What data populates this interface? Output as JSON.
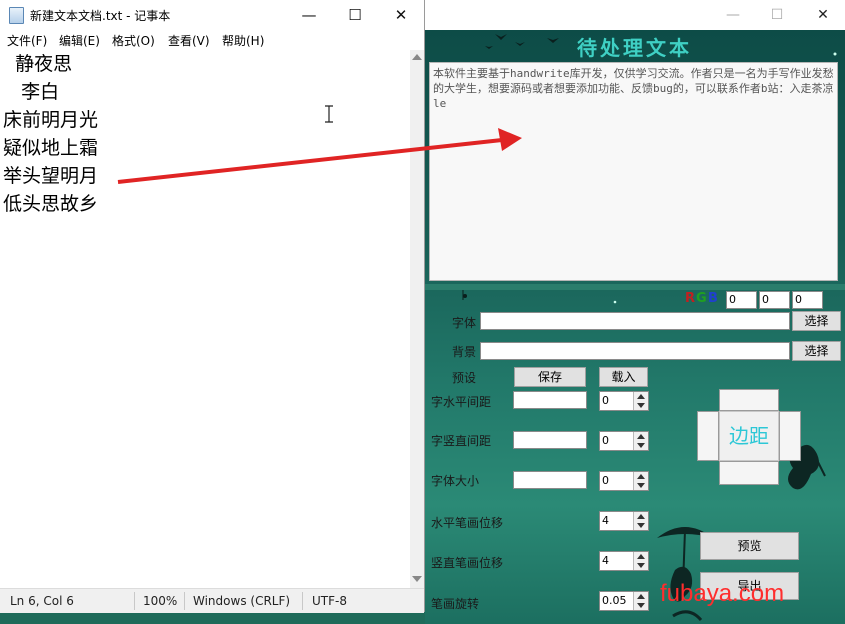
{
  "notepad": {
    "title": "新建文本文档.txt - 记事本",
    "controls": {
      "minimize": "—",
      "maximize": "☐",
      "close": "✕"
    },
    "menu": [
      "文件(F)",
      "编辑(E)",
      "格式(O)",
      "查看(V)",
      "帮助(H)"
    ],
    "lines": [
      "  静夜思",
      "   李白",
      "床前明月光",
      "疑似地上霜",
      "举头望明月",
      "低头思故乡"
    ],
    "status": {
      "position": "Ln 6, Col 6",
      "zoom": "100%",
      "line_ending": "Windows (CRLF)",
      "encoding": "UTF-8"
    }
  },
  "tool": {
    "controls": {
      "minimize": "—",
      "maximize": "☐",
      "close": "✕"
    },
    "header": "待处理文本",
    "text": "本软件主要基于handwrite库开发，仅供学习交流。作者只是一名为手写作业发愁的大学生，想要源码或者想要添加功能、反馈bug的，可以联系作者b站：入走茶凉le",
    "rgb": {
      "r_label": "R",
      "g_label": "G",
      "b_label": "B",
      "r": "0",
      "g": "0",
      "b": "0"
    },
    "font_label": "字体",
    "font_value": "",
    "background_label": "背景",
    "background_value": "",
    "select_label": "选择",
    "preset_label": "预设",
    "save_label": "保存",
    "load_label": "载入",
    "char_h_spacing_label": "字水平间距",
    "char_h_spacing": "0",
    "char_v_spacing_label": "字竖直间距",
    "char_v_spacing": "0",
    "font_size_label": "字体大小",
    "font_size": "0",
    "h_stroke_offset_label": "水平笔画位移",
    "h_stroke_offset": "4",
    "v_stroke_offset_label": "竖直笔画位移",
    "v_stroke_offset": "4",
    "stroke_rotation_label": "笔画旋转",
    "stroke_rotation": "0.05",
    "margin_label": "边距",
    "preview_label": "预览",
    "export_label": "导出"
  },
  "watermark": "fubaya.com",
  "colors": {
    "arrow": "#e02424",
    "header_text": "#3fd0c4",
    "margin_text": "#2cc7d6",
    "watermark": "#ff2d2d",
    "r": "#c02020",
    "g": "#20a020",
    "b": "#2040d0"
  }
}
